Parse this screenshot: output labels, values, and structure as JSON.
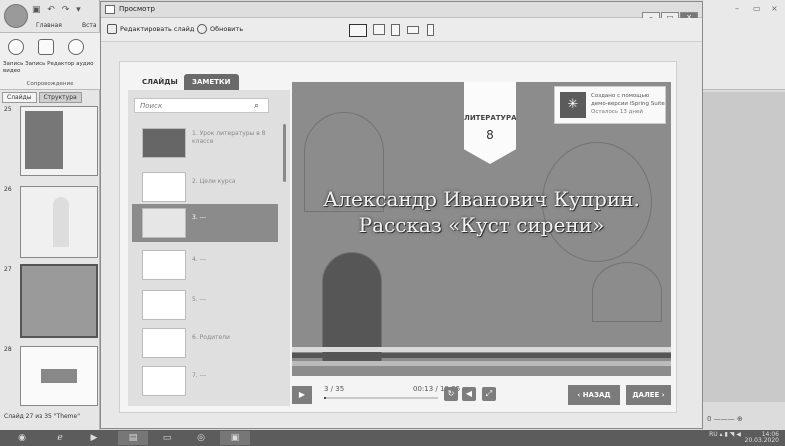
{
  "ppt": {
    "tabs": {
      "home": "Главная",
      "insert": "Вста"
    },
    "ribbon_labels": "Запись Запись Редактор аудио видео",
    "ribbon_group": "Сопровождение",
    "panel_tabs": [
      "Слайды",
      "Структура"
    ],
    "slide_numbers": [
      "25",
      "26",
      "27",
      "28"
    ],
    "status_left": "Слайд 27 из 35",
    "status_theme": "\"Theme\"",
    "zoom": "0"
  },
  "preview": {
    "title": "Просмотр",
    "toolbar": {
      "edit": "Редактировать слайд",
      "refresh": "Обновить"
    },
    "tabs": {
      "slides": "СЛАЙДЫ",
      "notes": "ЗАМЕТКИ"
    },
    "search_placeholder": "Поиск",
    "slides": [
      {
        "label": "1. Урок литературы в 8 классе"
      },
      {
        "label": "2. Цели курса"
      },
      {
        "label": "3. ---"
      },
      {
        "label": "4. ---"
      },
      {
        "label": "5. ---"
      },
      {
        "label": "6. Родители"
      },
      {
        "label": "7. ---"
      }
    ],
    "selected_index": 2
  },
  "slide": {
    "subject": "ЛИТЕРАТУРА",
    "grade": "8",
    "title_line1": "Александр Иванович Куприн.",
    "title_line2": "Рассказ «Куст сирени»",
    "badge_l1": "Создано с помощью",
    "badge_l2": "демо-версии iSpring Suite",
    "badge_l3": "Осталось 13 дней"
  },
  "player": {
    "counter": "3 / 35",
    "time": "00:13 / 10:35",
    "progress": 0.02,
    "back": "‹ НАЗАД",
    "next": "ДАЛЕЕ ›"
  },
  "tray": {
    "lang": "RU",
    "time": "14:06",
    "date": "20.03.2020"
  }
}
